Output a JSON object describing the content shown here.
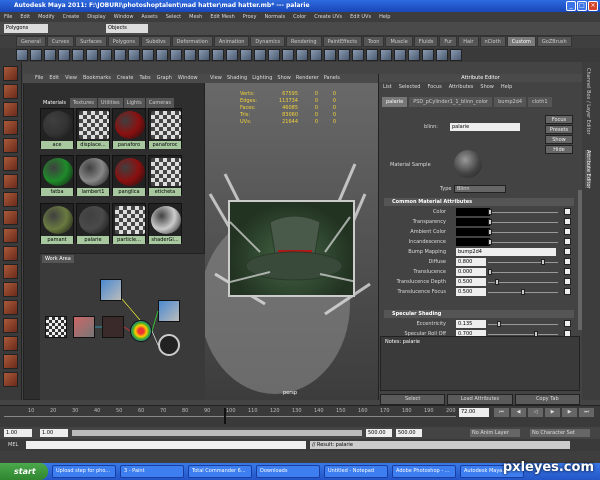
{
  "window": {
    "title": "Autodesk Maya 2011: F:\\JOBURI\\photoshoptalent\\mad hatter\\mad hatter.mb* --- palarie"
  },
  "menus": [
    "File",
    "Edit",
    "Modify",
    "Create",
    "Display",
    "Window",
    "Assets",
    "Select",
    "Mesh",
    "Edit Mesh",
    "Proxy",
    "Normals",
    "Color",
    "Create UVs",
    "Edit UVs",
    "Help"
  ],
  "status": {
    "mode": "Polygons",
    "objects": "Objects"
  },
  "shelf_tabs": [
    "General",
    "Curves",
    "Surfaces",
    "Polygons",
    "Subdivs",
    "Deformation",
    "Animation",
    "Dynamics",
    "Rendering",
    "PaintEffects",
    "Toon",
    "Muscle",
    "Fluids",
    "Fur",
    "Hair",
    "nCloth",
    "Custom",
    "GoZBrush"
  ],
  "shelf_active": "Custom",
  "hypershade": {
    "menu": [
      "File",
      "Edit",
      "View",
      "Bookmarks",
      "Create",
      "Tabs",
      "Graph",
      "Window"
    ],
    "tabs": [
      "Materials",
      "Textures",
      "Utilities",
      "Lights",
      "Cameras"
    ],
    "materials": [
      {
        "name": "ace",
        "color": "#333"
      },
      {
        "name": "displace...",
        "color": "checker"
      },
      {
        "name": "panaforo",
        "color": "#8b1010"
      },
      {
        "name": "panaforoc",
        "color": "checker"
      },
      {
        "name": "fatba",
        "color": "#1f8a2a"
      },
      {
        "name": "lambert1",
        "color": "#888"
      },
      {
        "name": "panglica",
        "color": "#8b1010"
      },
      {
        "name": "eticheta",
        "color": "checker"
      },
      {
        "name": "pamant",
        "color": "#6a7a40"
      },
      {
        "name": "palarie",
        "color": "#4a4a4a"
      },
      {
        "name": "particle...",
        "color": "checker"
      },
      {
        "name": "shaderGl...",
        "color": "#ccc"
      }
    ],
    "work_area": "Work Area"
  },
  "viewport": {
    "menu": [
      "View",
      "Shading",
      "Lighting",
      "Show",
      "Renderer",
      "Panels"
    ],
    "hud": [
      {
        "label": "Verts:",
        "v1": "67595",
        "v2": "0",
        "v3": "0"
      },
      {
        "label": "Edges:",
        "v1": "113734",
        "v2": "0",
        "v3": "0"
      },
      {
        "label": "Faces:",
        "v1": "46085",
        "v2": "0",
        "v3": "0"
      },
      {
        "label": "Tris:",
        "v1": "83060",
        "v2": "0",
        "v3": "0"
      },
      {
        "label": "UVs:",
        "v1": "21644",
        "v2": "0",
        "v3": "0"
      }
    ],
    "camera": "persp"
  },
  "attribute_editor": {
    "title": "Attribute Editor",
    "menu": [
      "List",
      "Selected",
      "Focus",
      "Attributes",
      "Show",
      "Help"
    ],
    "tabs": [
      "palarie",
      "PSD_pCylinder1_1_blinn_color",
      "bump2d4",
      "cloth1"
    ],
    "node_type": "blinn:",
    "node_name": "palarie",
    "buttons": [
      "Focus",
      "Presets",
      "Show",
      "Hide"
    ],
    "material_sample": "Material Sample",
    "type_label": "Type",
    "type_value": "Blinn",
    "common_section": "Common Material Attributes",
    "attrs": [
      {
        "label": "Color",
        "kind": "swatch"
      },
      {
        "label": "Transparency",
        "kind": "swatch"
      },
      {
        "label": "Ambient Color",
        "kind": "swatch"
      },
      {
        "label": "Incandescence",
        "kind": "swatch"
      },
      {
        "label": "Bump Mapping",
        "kind": "text",
        "value": "bump2d4"
      },
      {
        "label": "Diffuse",
        "kind": "num",
        "value": "0.800",
        "fraction": 0.8
      },
      {
        "label": "Translucence",
        "kind": "num",
        "value": "0.000",
        "fraction": 0.0
      },
      {
        "label": "Translucence Depth",
        "kind": "num",
        "value": "0.500",
        "fraction": 0.1
      },
      {
        "label": "Translucence Focus",
        "kind": "num",
        "value": "0.500",
        "fraction": 0.5
      }
    ],
    "specular_section": "Specular Shading",
    "specular_attrs": [
      {
        "label": "Eccentricity",
        "kind": "num",
        "value": "0.135",
        "fraction": 0.135
      },
      {
        "label": "Specular Roll Off",
        "kind": "num",
        "value": "0.700",
        "fraction": 0.7
      }
    ],
    "notes": "Notes: palarie",
    "bottom_buttons": [
      "Select",
      "Load Attributes",
      "Copy Tab"
    ]
  },
  "side_tabs": [
    "Channel Box / Layer Editor",
    "Attribute Editor"
  ],
  "timeline": {
    "ticks": [
      "10",
      "20",
      "30",
      "40",
      "50",
      "60",
      "70",
      "80",
      "90",
      "100",
      "110",
      "120",
      "130",
      "140",
      "150",
      "160",
      "170",
      "180",
      "190",
      "200"
    ],
    "current": "72.00"
  },
  "range": {
    "start": "1.00",
    "inner_start": "1.00",
    "end": "500.00",
    "inner_end": "500.00",
    "anim_layer": "No Anim Layer",
    "character": "No Character Set"
  },
  "command": {
    "label": "MEL",
    "result": "// Result: palarie"
  },
  "taskbar": {
    "start": "start",
    "tasks": [
      "Upload step for pho...",
      "3 - Paint",
      "Total Commander 6...",
      "Downloads",
      "Untitled - Notepad",
      "Adobe Photoshop - ...",
      "Autodesk Maya..."
    ]
  },
  "watermark": "pxleyes.com"
}
